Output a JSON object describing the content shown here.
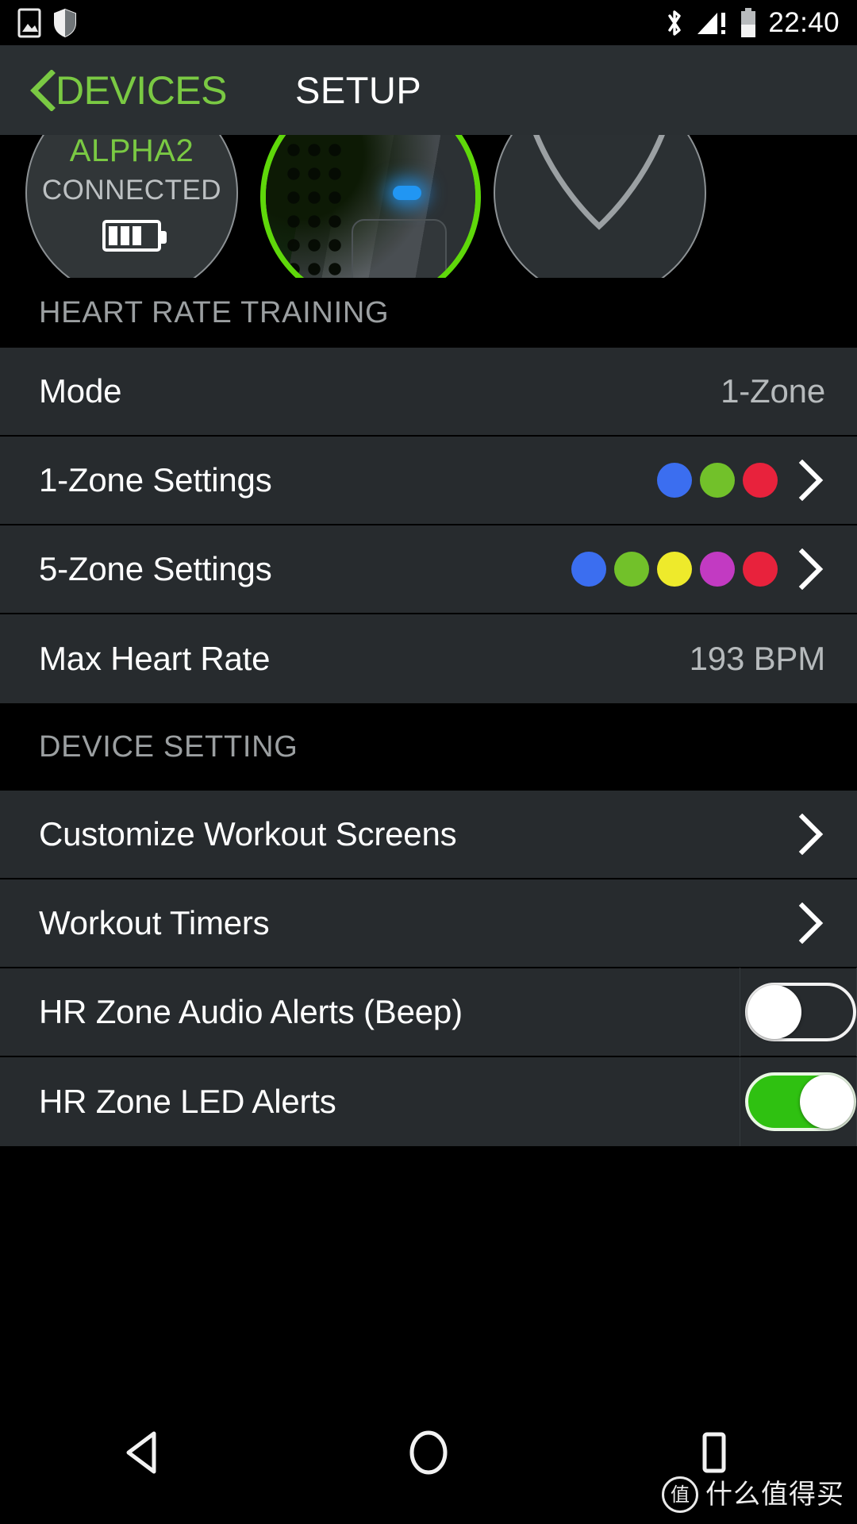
{
  "statusbar": {
    "time": "22:40",
    "icons": [
      "photo-icon",
      "shield-icon",
      "bluetooth-icon",
      "cellular-signal-icon",
      "battery-icon"
    ]
  },
  "header": {
    "back_label": "DEVICES",
    "title": "SETUP",
    "accent_color": "#7ac943"
  },
  "carousel": {
    "devices": [
      {
        "name": "ALPHA2",
        "status": "CONNECTED",
        "battery_bars": 3
      },
      {
        "name": "",
        "status": "",
        "selected": true
      },
      {
        "name": "",
        "status": "",
        "placeholder": "---"
      }
    ]
  },
  "sections": [
    {
      "title": "HEART RATE TRAINING",
      "rows": [
        {
          "label": "Mode",
          "value": "1-Zone",
          "type": "value"
        },
        {
          "label": "1-Zone Settings",
          "type": "dots-chevron",
          "dots": [
            "#3b6ef0",
            "#72c12a",
            "#e8223c"
          ]
        },
        {
          "label": "5-Zone Settings",
          "type": "dots-chevron",
          "dots": [
            "#3b6ef0",
            "#72c12a",
            "#eeea2b",
            "#c23ac2",
            "#e8223c"
          ]
        },
        {
          "label": "Max Heart Rate",
          "value": "193 BPM",
          "type": "value"
        }
      ]
    },
    {
      "title": "DEVICE SETTING",
      "rows": [
        {
          "label": "Customize Workout Screens",
          "type": "chevron"
        },
        {
          "label": "Workout Timers",
          "type": "chevron"
        },
        {
          "label": "HR Zone Audio Alerts (Beep)",
          "type": "toggle",
          "state": "off"
        },
        {
          "label": "HR Zone LED Alerts",
          "type": "toggle",
          "state": "on"
        }
      ]
    }
  ],
  "navbar": {
    "buttons": [
      "back-nav-icon",
      "home-nav-icon",
      "recents-nav-icon"
    ]
  },
  "watermark": {
    "badge": "值",
    "text": "什么值得买"
  }
}
